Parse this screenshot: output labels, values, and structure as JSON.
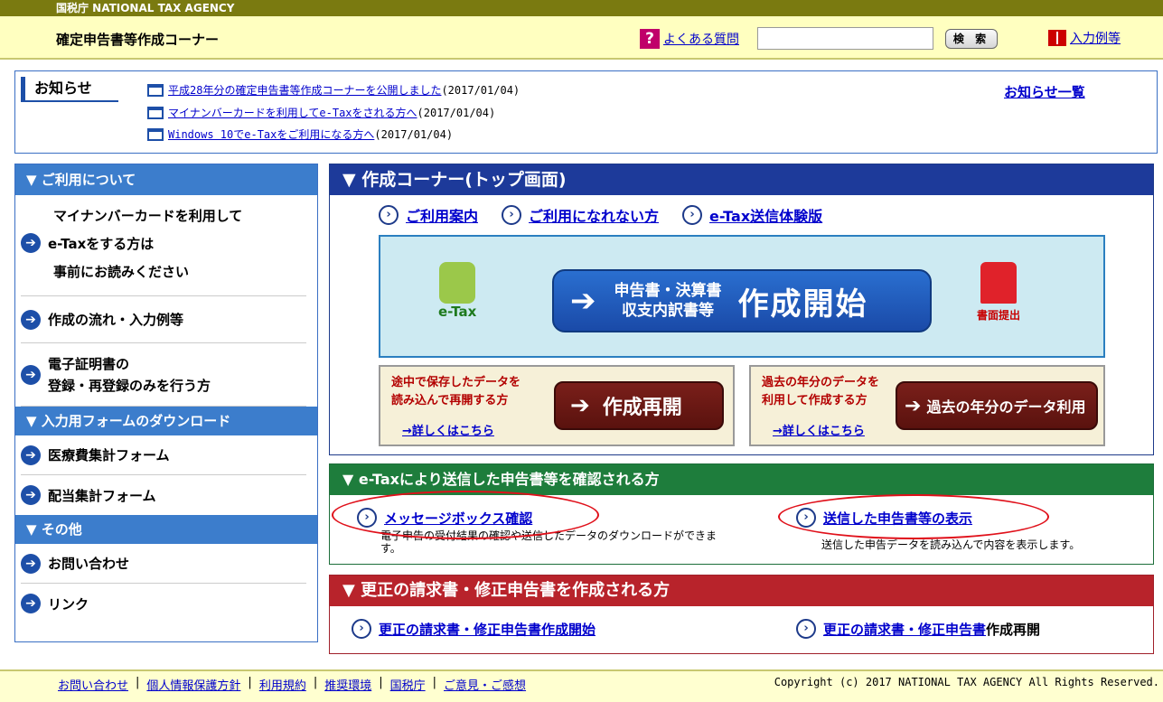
{
  "agency_bar": "国税庁  NATIONAL TAX AGENCY",
  "header": {
    "title": "確定申告書等作成コーナー",
    "faq_label": "よくある質問",
    "search_value": "",
    "search_button": "検 索",
    "examples_label": "入力例等"
  },
  "notice": {
    "label": "お知らせ",
    "all_link": "お知らせ一覧",
    "items": [
      {
        "text": "平成28年分の確定申告書等作成コーナーを公開しました ",
        "date": "(2017/01/04)"
      },
      {
        "text": "マイナンバーカードを利用してe-Taxをされる方へ",
        "date": "(2017/01/04)"
      },
      {
        "text": "Windows 10でe-Taxをご利用になる方へ",
        "date": "(2017/01/04)"
      }
    ]
  },
  "sidebar": {
    "usage_head": "▼  ご利用について",
    "mynumber_l1": "マイナンバーカードを利用して",
    "mynumber_l2": "e-Taxをする方は",
    "mynumber_l3": "事前にお読みください",
    "flow": "作成の流れ・入力例等",
    "cert_l1": "電子証明書の",
    "cert_l2": "登録・再登録のみを行う方",
    "download_head": "▼  入力用フォームのダウンロード",
    "medical": "医療費集計フォーム",
    "dividend": "配当集計フォーム",
    "other_head": "▼  その他",
    "contact": "お問い合わせ",
    "link": "リンク"
  },
  "main": {
    "head": "▼  作成コーナー(トップ画面)",
    "guide": "ご利用案内",
    "cannot_use": "ご利用になれない方",
    "trial": "e-Tax送信体験版",
    "etax_logo": "e-Tax",
    "start_sub_l1": "申告書・決算書",
    "start_sub_l2": "収支内訳書等",
    "start_go": "作成開始",
    "paper_logo": "書面提出",
    "resume_desc_l1": "途中で保存したデータを",
    "resume_desc_l2": "読み込んで再開する方",
    "resume_more": "→詳しくはこちら",
    "resume_btn": "作成再開",
    "past_desc_l1": "過去の年分のデータを",
    "past_desc_l2": "利用して作成する方",
    "past_more": "→詳しくはこちら",
    "past_btn": "過去の年分のデータ利用"
  },
  "confirm": {
    "head": "▼  e-Taxにより送信した申告書等を確認される方",
    "msgbox": "メッセージボックス確認",
    "msgbox_desc_l1": "電子申告の受付結果の確認や送信したデータのダウンロードができま",
    "msgbox_desc_l2": "す。",
    "sent": "送信した申告書等の表示",
    "sent_desc": "送信した申告データを読み込んで内容を表示します。"
  },
  "correct": {
    "head": "▼  更正の請求書・修正申告書を作成される方",
    "start": "更正の請求書・修正申告書作成開始",
    "resume_link": "更正の請求書・修正申告書",
    "resume_tail": "作成再開"
  },
  "footer": {
    "links": [
      "お問い合わせ",
      "個人情報保護方針",
      "利用規約",
      "推奨環境",
      "国税庁",
      "ご意見・ご感想"
    ],
    "copyright": "Copyright (c) 2017 NATIONAL TAX AGENCY All Rights Reserved."
  },
  "colors": {
    "navy": "#1d3a9a",
    "sidebar_blue": "#3c7dcc",
    "confirm_green": "#1e7d3c",
    "correct_red": "#b8232b",
    "highlight_red": "#e0101a"
  }
}
